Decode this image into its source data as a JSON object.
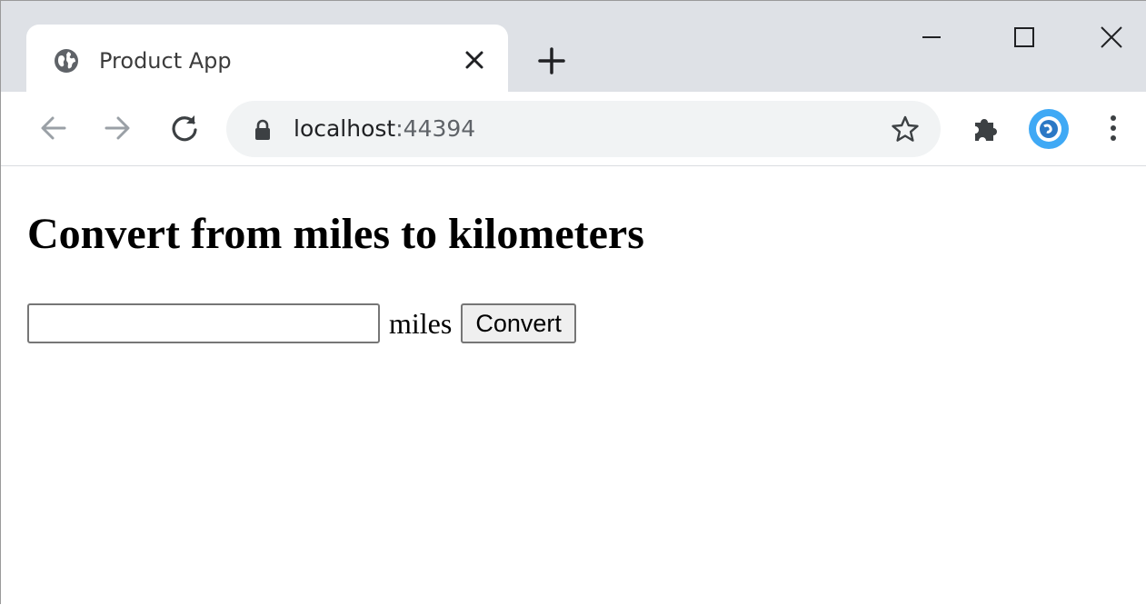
{
  "browser": {
    "tab": {
      "title": "Product App",
      "favicon": "globe-icon"
    },
    "new_tab": "plus-icon",
    "window_controls": [
      "minimize-icon",
      "maximize-icon",
      "close-icon"
    ],
    "toolbar": {
      "back": "arrow-left-icon",
      "forward": "arrow-right-icon",
      "reload": "reload-icon",
      "url_host": "localhost",
      "url_port": ":44394",
      "secure": "lock-icon",
      "bookmark": "star-icon",
      "extensions": "puzzle-icon",
      "profile": "profile-avatar",
      "menu": "kebab-menu-icon"
    },
    "colors": {
      "tabstrip": "#dee1e6",
      "omnibox": "#f1f3f4",
      "profile": "#3fa9f5"
    }
  },
  "page": {
    "heading": "Convert from miles to kilometers",
    "form": {
      "input_value": "",
      "unit_label": "miles",
      "button_label": "Convert"
    }
  }
}
